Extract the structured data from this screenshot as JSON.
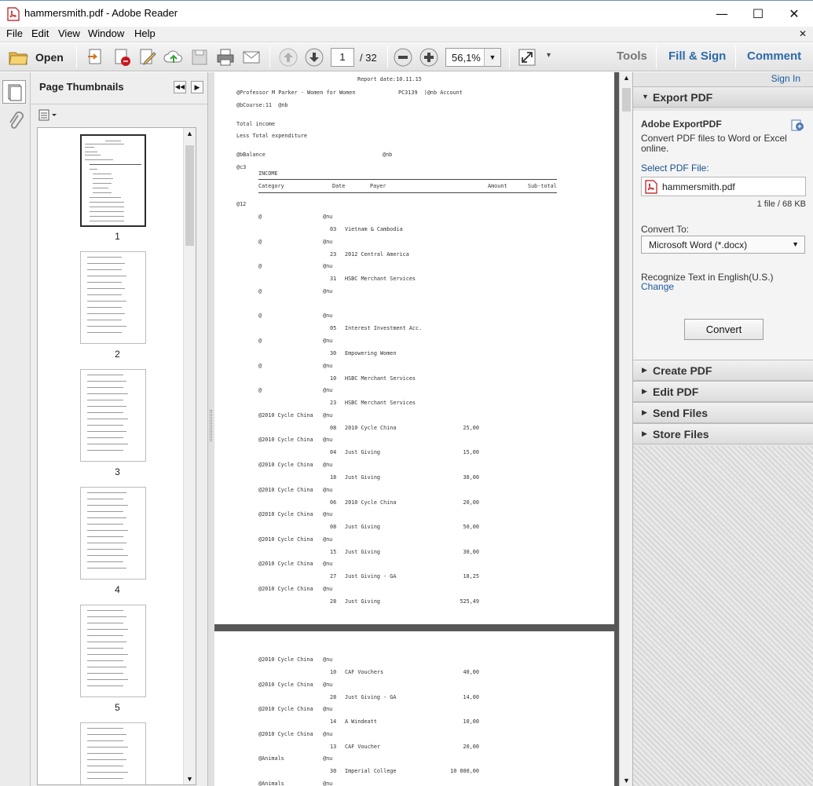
{
  "window": {
    "title": "hammersmith.pdf - Adobe Reader",
    "minimize": "—",
    "maximize": "☐",
    "close": "✕"
  },
  "menu": {
    "items": [
      "File",
      "Edit",
      "View",
      "Window",
      "Help"
    ],
    "close_doc": "✕"
  },
  "toolbar": {
    "open_label": "Open",
    "page_current": "1",
    "page_total": "/ 32",
    "zoom": "56,1%",
    "tools": "Tools",
    "fill_sign": "Fill & Sign",
    "comment": "Comment"
  },
  "thumbnails": {
    "title": "Page Thumbnails",
    "pages": [
      "1",
      "2",
      "3",
      "4",
      "5"
    ]
  },
  "document": {
    "page1": {
      "report_date": "Report date:10.11.15",
      "header_line": "@Professor M Parker - Women for Women",
      "header_code": "PC3139  )@nb Account",
      "course": "@bCourse:11  @nb",
      "total_income": "Total income",
      "less_expenditure": "Less Total expenditure",
      "balance": "@bBalance",
      "balance_nb": "@nb",
      "c3": "@c3",
      "income": "INCOME",
      "col_category": "Category",
      "col_date": "Date",
      "col_payer": "Payer",
      "col_amount": "Amount",
      "col_subtotal": "Sub-total",
      "i2": "@12",
      "rows": [
        {
          "cat": "@",
          "nu": "@nu",
          "date": "03",
          "payer": "Vietnam & Cambodia",
          "amount": ""
        },
        {
          "cat": "@",
          "nu": "@nu",
          "date": "23",
          "payer": "2012 Central America",
          "amount": ""
        },
        {
          "cat": "@",
          "nu": "@nu",
          "date": "31",
          "payer": "HSBC Merchant Services",
          "amount": ""
        },
        {
          "cat": "@",
          "nu": "@nu",
          "date": "",
          "payer": "",
          "amount": ""
        },
        {
          "cat": "@",
          "nu": "@nu",
          "date": "05",
          "payer": "Interest Investment Acc.",
          "amount": ""
        },
        {
          "cat": "@",
          "nu": "@nu",
          "date": "30",
          "payer": "Empowering Women",
          "amount": ""
        },
        {
          "cat": "@",
          "nu": "@nu",
          "date": "10",
          "payer": "HSBC Merchant Services",
          "amount": ""
        },
        {
          "cat": "@",
          "nu": "@nu",
          "date": "23",
          "payer": "HSBC Merchant Services",
          "amount": ""
        },
        {
          "cat": "@2010 Cycle China",
          "nu": "@nu",
          "date": "08",
          "payer": "2010 Cycle China",
          "amount": "25,00"
        },
        {
          "cat": "@2010 Cycle China",
          "nu": "@nu",
          "date": "04",
          "payer": "Just Giving",
          "amount": "15,00"
        },
        {
          "cat": "@2010 Cycle China",
          "nu": "@nu",
          "date": "18",
          "payer": "Just Giving",
          "amount": "30,00"
        },
        {
          "cat": "@2010 Cycle China",
          "nu": "@nu",
          "date": "06",
          "payer": "2010 Cycle China",
          "amount": "20,00"
        },
        {
          "cat": "@2010 Cycle China",
          "nu": "@nu",
          "date": "08",
          "payer": "Just Giving",
          "amount": "50,00"
        },
        {
          "cat": "@2010 Cycle China",
          "nu": "@nu",
          "date": "15",
          "payer": "Just Giving",
          "amount": "30,00"
        },
        {
          "cat": "@2010 Cycle China",
          "nu": "@nu",
          "date": "27",
          "payer": "Just Giving - GA",
          "amount": "18,25"
        },
        {
          "cat": "@2010 Cycle China",
          "nu": "@nu",
          "date": "28",
          "payer": "Just Giving",
          "amount": "525,49"
        }
      ]
    },
    "page2": {
      "rows": [
        {
          "cat": "@2010 Cycle China",
          "nu": "@nu",
          "date": "10",
          "payer": "CAF Vouchers",
          "amount": "40,00"
        },
        {
          "cat": "@2010 Cycle China",
          "nu": "@nu",
          "date": "28",
          "payer": "Just Giving - GA",
          "amount": "14,00"
        },
        {
          "cat": "@2010 Cycle China",
          "nu": "@nu",
          "date": "14",
          "payer": "A Windeatt",
          "amount": "10,00"
        },
        {
          "cat": "@2010 Cycle China",
          "nu": "@nu",
          "date": "13",
          "payer": "CAF Voucher",
          "amount": "20,00"
        },
        {
          "cat": "@Animals",
          "nu": "@nu",
          "date": "30",
          "payer": "Imperial College",
          "amount": "10 000,00"
        },
        {
          "cat": "@Animals",
          "nu": "@nu",
          "date": "",
          "payer": "",
          "amount": ""
        }
      ]
    }
  },
  "export_panel": {
    "sign_in": "Sign In",
    "section_title": "Export PDF",
    "product": "Adobe ExportPDF",
    "desc": "Convert PDF files to Word or Excel online.",
    "select_label": "Select PDF File:",
    "file_name": "hammersmith.pdf",
    "file_info": "1 file / 68 KB",
    "convert_to_label": "Convert To:",
    "convert_to_value": "Microsoft Word (*.docx)",
    "recognize": "Recognize Text in English(U.S.)",
    "change": "Change",
    "convert_button": "Convert",
    "sections": [
      "Create PDF",
      "Edit PDF",
      "Send Files",
      "Store Files"
    ]
  },
  "colors": {
    "accent_blue": "#2c6aa8",
    "link_blue": "#1a5a9c",
    "pdf_red": "#c8181e"
  }
}
